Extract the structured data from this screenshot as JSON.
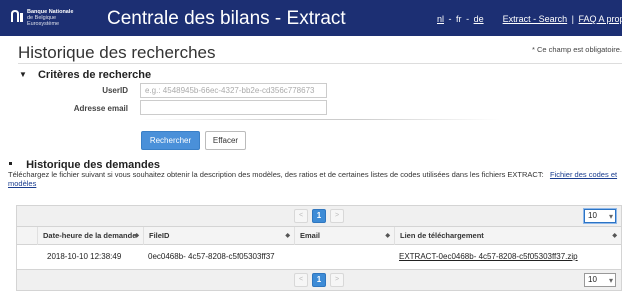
{
  "header": {
    "logo_line1": "Banque Nationale",
    "logo_line2": "de Belgique",
    "logo_line3": "Eurosystème",
    "app_title": "Centrale des bilans - Extract",
    "lang_nl": "nl",
    "lang_sep1": "-",
    "lang_fr": "fr",
    "lang_sep2": "-",
    "lang_de": "de",
    "link_search": "Extract - Search",
    "link_sep": "|",
    "link_faq": "FAQ A propos"
  },
  "page": {
    "title": "Historique des recherches",
    "required_note": "* Ce champ est obligatoire."
  },
  "criteria": {
    "toggle": "▼",
    "title": "Critères de recherche",
    "userid_label": "UserID",
    "userid_placeholder": "e.g.: 4548945b-66ec-4327-bb2e-cd356c778673",
    "userid_value": "",
    "email_label": "Adresse email",
    "email_value": "",
    "search_button": "Rechercher",
    "clear_button": "Effacer"
  },
  "history": {
    "title": "Historique des demandes",
    "intro_text": "Téléchargez le fichier suivant si vous souhaitez obtenir la description des modèles, des ratios et de certaines listes de codes utilisées dans les fichiers EXTRACT:",
    "intro_link": "Fichier des codes et modèles"
  },
  "grid": {
    "pager_prev": "<",
    "pager_current": "1",
    "pager_next": ">",
    "page_size_top": "10",
    "page_size_bottom": "10",
    "columns": [
      {
        "label": "Date-heure de la demande"
      },
      {
        "label": "FileID"
      },
      {
        "label": "Email"
      },
      {
        "label": "Lien de téléchargement"
      }
    ],
    "rows": [
      {
        "date": "2018-10-10 12:38:49",
        "file_id": "0ec0468b-        4c57-8208-c5f05303ff37",
        "email": "",
        "link": "EXTRACT-0ec0468b-        4c57-8208-c5f05303ff37.zip"
      }
    ]
  }
}
